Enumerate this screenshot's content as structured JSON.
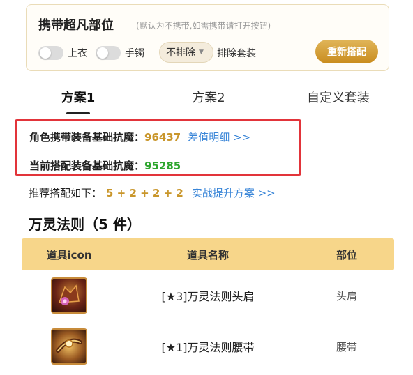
{
  "carry_panel": {
    "title": "携带超凡部位",
    "hint": "(默认为不携带,如需携带请打开按钮)",
    "toggles": [
      {
        "label": "上衣",
        "on": false
      },
      {
        "label": "手镯",
        "on": false
      }
    ],
    "exclude_select": {
      "value": "不排除"
    },
    "exclude_label": "排除套装",
    "rematch_button": "重新搭配"
  },
  "tabs": [
    {
      "label": "方案1",
      "active": true
    },
    {
      "label": "方案2",
      "active": false
    },
    {
      "label": "自定义套装",
      "active": false
    }
  ],
  "stats": {
    "carry_label": "角色携带装备基础抗魔：",
    "carry_value": "96437",
    "diff_link": "差值明细 >>",
    "current_label": "当前搭配装备基础抗魔：",
    "current_value": "95285"
  },
  "recommend": {
    "label": "推荐搭配如下：",
    "formula": "5 + 2 + 2 + 2",
    "link": "实战提升方案 >>"
  },
  "set": {
    "title": "万灵法则（5 件）",
    "columns": [
      "道具icon",
      "道具名称",
      "部位"
    ],
    "rows": [
      {
        "icon": "shoulder-item-icon",
        "name": "[★3]万灵法则头肩",
        "part": "头肩"
      },
      {
        "icon": "belt-item-icon",
        "name": "[★1]万灵法则腰带",
        "part": "腰带"
      }
    ]
  },
  "colors": {
    "accent_gold": "#c9962b",
    "value_green": "#2ea62e",
    "link_blue": "#3a86d8",
    "highlight_red": "#e2343a",
    "table_header": "#f7d68a"
  }
}
